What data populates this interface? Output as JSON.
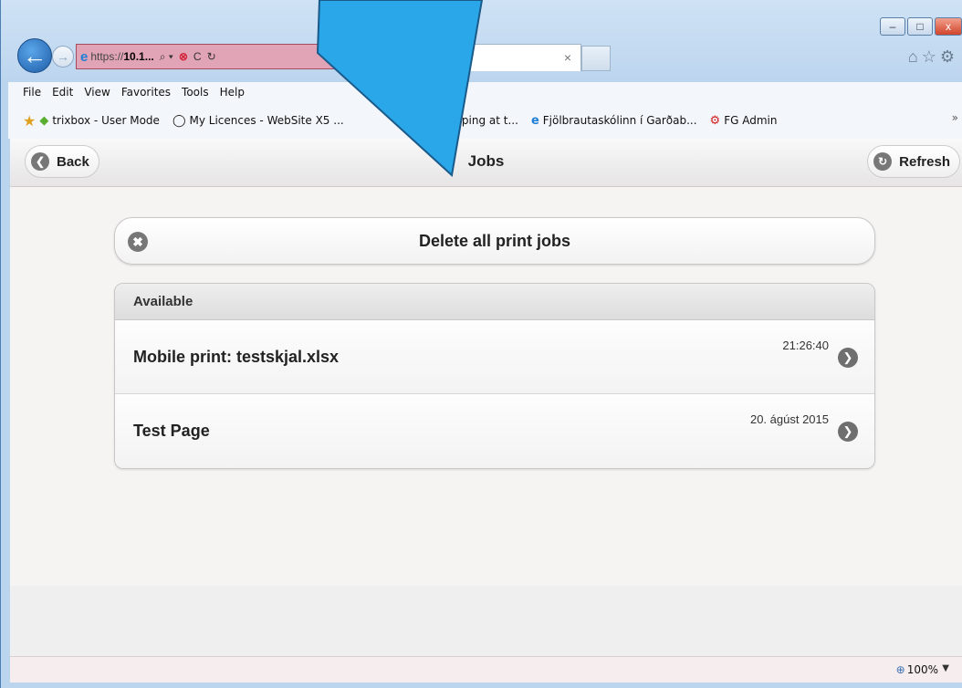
{
  "browser": {
    "window_buttons": [
      "–",
      "□",
      "x"
    ],
    "address": {
      "prefix": "https://",
      "host": "10.1...",
      "search_glyph": "⌕ ▾",
      "error_glyph": "⊗",
      "extra": "C",
      "refresh_glyph": "↻"
    },
    "tab_title": "J",
    "tab_close": "×",
    "menu": [
      "File",
      "Edit",
      "View",
      "Favorites",
      "Tools",
      "Help"
    ],
    "favorites": [
      {
        "icon": "green-diamond-icon",
        "label": "trixbox - User Mode"
      },
      {
        "icon": "circle-icon",
        "label": "My Licences - WebSite X5 ..."
      },
      {
        "icon": "",
        "label": "h yourself typing at t..."
      },
      {
        "icon": "ie-icon",
        "label": "Fjölbrautaskólinn í Garðab..."
      },
      {
        "icon": "red-gear-icon",
        "label": "FG Admin"
      }
    ],
    "favorites_more": "»",
    "zoom": "100%"
  },
  "app": {
    "back_label": "Back",
    "title": "Jobs",
    "refresh_label": "Refresh",
    "delete_label": "Delete all print jobs",
    "list_header": "Available",
    "jobs": [
      {
        "title": "Mobile print: testskjal.xlsx",
        "time": "21:26:40"
      },
      {
        "title": "Test Page",
        "time": "20. ágúst 2015"
      }
    ]
  },
  "colors": {
    "annotation_arrow": "#2aa7e8",
    "accent_blue": "#1e5ea8"
  }
}
